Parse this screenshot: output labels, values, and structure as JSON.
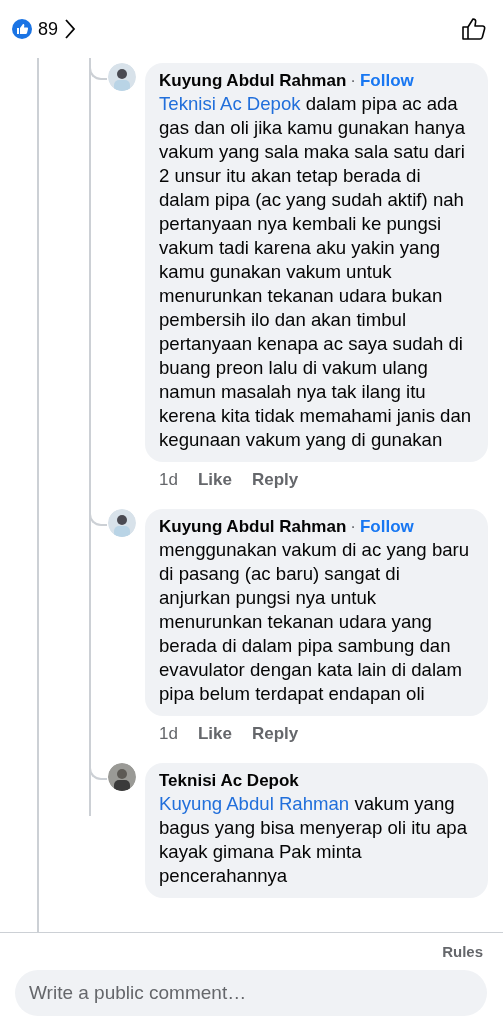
{
  "header": {
    "reaction_count": "89"
  },
  "comments": [
    {
      "author": "Kuyung Abdul Rahman",
      "separator": "·",
      "follow": "Follow",
      "mention": "Teknisi Ac Depok",
      "text": " dalam pipa ac ada gas dan oli  jika kamu gunakan hanya vakum yang sala maka sala satu dari 2 unsur itu akan tetap berada di dalam pipa (ac yang sudah aktif) nah pertanyaan nya kembali ke pungsi vakum tadi karena aku yakin yang kamu gunakan vakum untuk menurunkan tekanan udara bukan pembersih ilo dan akan timbul pertanyaan kenapa ac saya sudah di buang preon lalu di vakum ulang namun masalah nya tak ilang  itu kerena kita tidak memahami janis dan kegunaan vakum yang di gunakan",
      "time": "1d",
      "like": "Like",
      "reply": "Reply"
    },
    {
      "author": "Kuyung Abdul Rahman",
      "separator": "·",
      "follow": "Follow",
      "text": "menggunakan vakum di ac yang baru di pasang (ac baru) sangat di anjurkan pungsi nya untuk menurunkan tekanan udara yang berada di dalam pipa sambung dan evavulator dengan kata lain di dalam pipa belum terdapat endapan oli",
      "time": "1d",
      "like": "Like",
      "reply": "Reply"
    },
    {
      "author": "Teknisi Ac Depok",
      "mention": "Kuyung Abdul Rahman",
      "text": " vakum yang bagus yang bisa menyerap oli itu apa kayak gimana Pak minta pencerahannya"
    }
  ],
  "footer": {
    "rules": "Rules",
    "composer": {
      "placeholder": "Write a public comment…"
    }
  }
}
